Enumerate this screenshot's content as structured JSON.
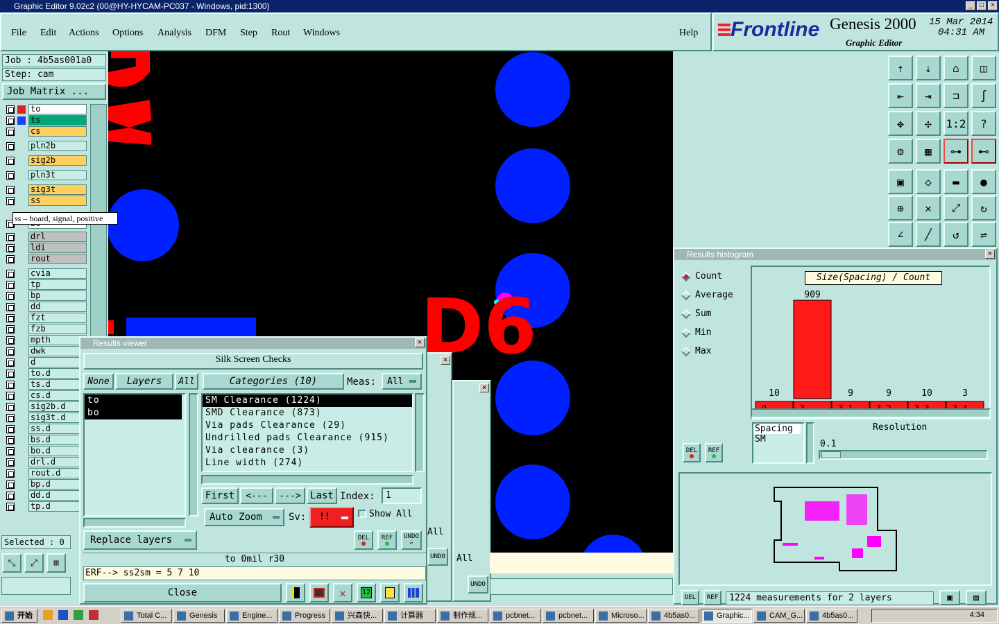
{
  "window": {
    "title": "Graphic Editor 9.02c2 (00@HY-HYCAM-PC037 - Windows, pid:1300)"
  },
  "menu": [
    "File",
    "Edit",
    "Actions",
    "Options",
    "Analysis",
    "DFM",
    "Step",
    "Rout",
    "Windows"
  ],
  "help": "Help",
  "brand": {
    "logo": "Frontline",
    "product": "Genesis 2000",
    "subtitle": "Graphic Editor",
    "date": "15 Mar 2014",
    "time": "04:31 AM"
  },
  "job": {
    "job": "Job  : 4b5as001a0",
    "step": "Step: cam",
    "matrix": "Job Matrix ..."
  },
  "layers": [
    "to",
    "ts",
    "cs",
    "pln2b",
    "sig2b",
    "pln3t",
    "sig3t",
    "ss",
    "bo",
    "drl",
    "ldi",
    "rout",
    "cvia",
    "tp",
    "bp",
    "dd",
    "fzt",
    "fzb",
    "mpth",
    "dwk",
    "d",
    "to.d",
    "ts.d",
    "cs.d",
    "sig2b.d",
    "sig3t.d",
    "ss.d",
    "bs.d",
    "bo.d",
    "drl.d",
    "rout.d",
    "bp.d",
    "dd.d",
    "tp.d"
  ],
  "tooltip": "ss – board, signal, positive",
  "selected": "Selected : 0",
  "canvas_labels": {
    "ref": "D6"
  },
  "results_viewer": {
    "title": "Results viewer",
    "heading": "Silk Screen Checks",
    "none": "None",
    "layers": "Layers",
    "all": "All",
    "categories": "Categories (10)",
    "meas": "Meas:",
    "meas_value": "All",
    "layer_items": [
      "to",
      "bo"
    ],
    "category_items": [
      "SM Clearance (1224)",
      "SMD Clearance (873)",
      "Via pads Clearance (29)",
      "Undrilled pads Clearance (915)",
      "Via clearance (3)",
      "Line width (274)"
    ],
    "first": "First",
    "prev": "<---",
    "next": "--->",
    "last": "Last",
    "index_label": "Index:",
    "index_value": "1",
    "auto_zoom": "Auto Zoom",
    "sv": "Sv:",
    "sv_value": "!!",
    "show_all": "Show All",
    "del": "DEL",
    "ref": "REF",
    "undo": "UNDO",
    "replace": "Replace layers",
    "status": "to 0mil  r30",
    "erf": "ERF--> ss2sm = 5 7 10",
    "close": "Close"
  },
  "background_windows": {
    "all1": "All",
    "all2": "All",
    "undo": "UNDO"
  },
  "histogram": {
    "title": "Results histogram",
    "options": [
      "Count",
      "Average",
      "Sum",
      "Min",
      "Max"
    ],
    "selected_option": "Count",
    "chart_title": "Size(Spacing) / Count",
    "del": "DEL",
    "ref": "REF",
    "spacing_label": "Spacing",
    "spacing_value": "SM",
    "resolution_label": "Resolution",
    "resolution_value": "0.1",
    "status": "1224 measurements for 2 layers"
  },
  "chart_data": {
    "type": "bar",
    "title": "Size(Spacing) / Count",
    "categories": [
      "0-0.1",
      "3-3.1",
      "3.1-3.2",
      "3.2-3.3",
      "3.3-3.4",
      "3.4-3.5"
    ],
    "values": [
      10,
      909,
      9,
      9,
      10,
      3
    ],
    "ylim": [
      0,
      1000
    ],
    "bar_color": "#ff1a1a"
  },
  "taskbar": {
    "start": "开始",
    "tasks": [
      "Total C...",
      "Genesis",
      "Engine...",
      "Progress",
      "兴森快...",
      "计算器",
      "制作规...",
      "pcbnet...",
      "pcbnet...",
      "Microso...",
      "4b5as0...",
      "Graphic...",
      "CAM_G...",
      "4b5as0..."
    ],
    "clock": "4:34"
  }
}
